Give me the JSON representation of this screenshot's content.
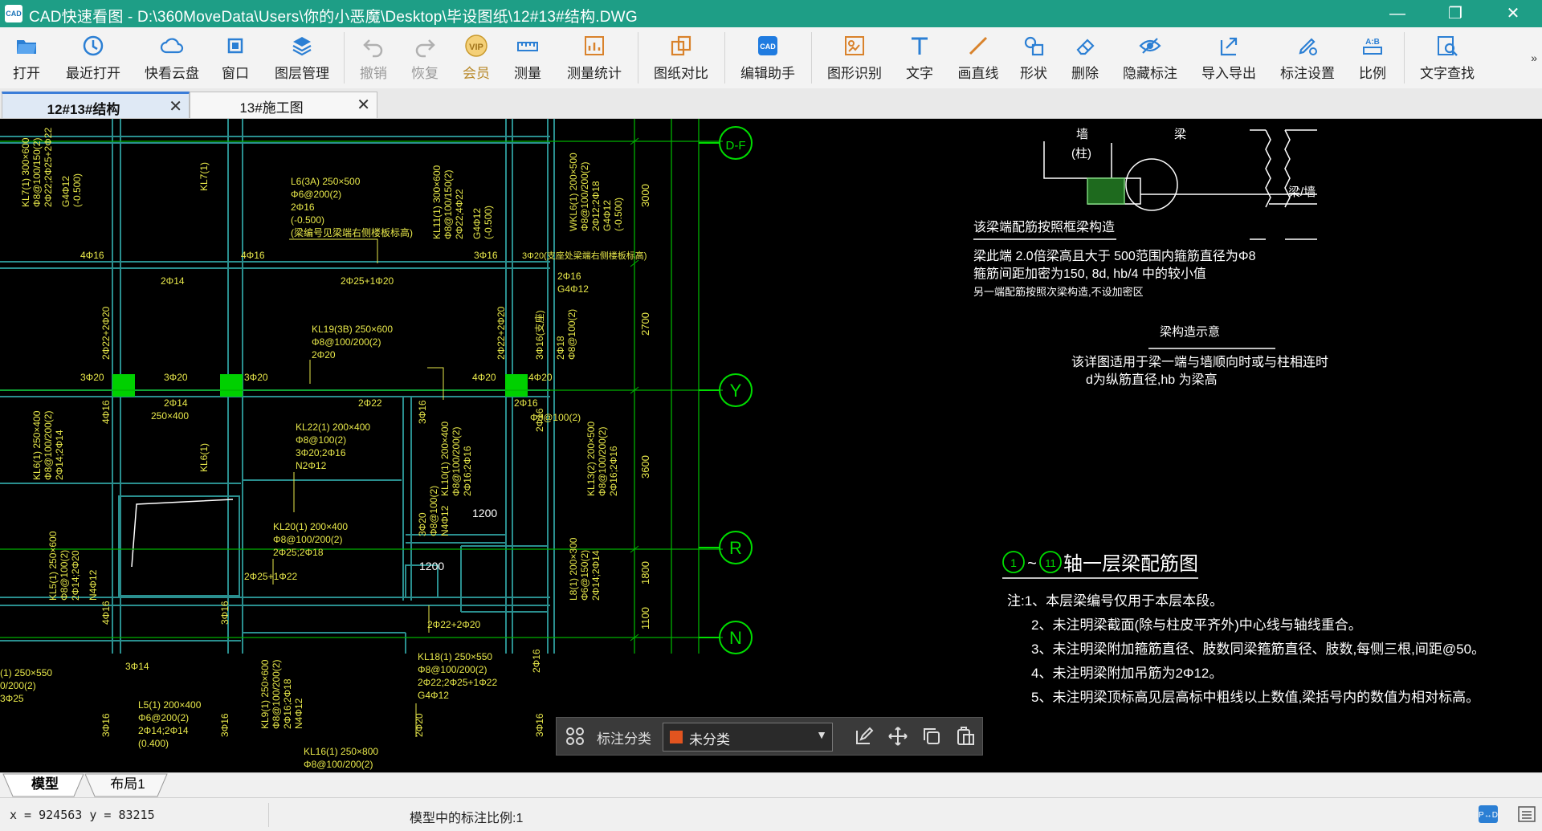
{
  "window": {
    "title": "CAD快速看图 - D:\\360MoveData\\Users\\你的小恶魔\\Desktop\\毕设图纸\\12#13#结构.DWG",
    "icon_text": "CAD",
    "controls": [
      "minimize-icon",
      "maximize-icon",
      "close-icon"
    ]
  },
  "toolbar": {
    "items": [
      {
        "label": "打开",
        "icon": "folder-open-icon"
      },
      {
        "label": "最近打开",
        "icon": "recent-icon"
      },
      {
        "label": "快看云盘",
        "icon": "cloud-icon"
      },
      {
        "label": "窗口",
        "icon": "window-icon"
      },
      {
        "label": "图层管理",
        "icon": "layers-icon"
      },
      {
        "label": "撤销",
        "icon": "undo-icon"
      },
      {
        "label": "恢复",
        "icon": "redo-icon"
      },
      {
        "label": "会员",
        "icon": "vip-icon"
      },
      {
        "label": "测量",
        "icon": "measure-icon"
      },
      {
        "label": "测量统计",
        "icon": "measure-stats-icon"
      },
      {
        "label": "图纸对比",
        "icon": "compare-icon"
      },
      {
        "label": "编辑助手",
        "icon": "edit-assistant-icon"
      },
      {
        "label": "图形识别",
        "icon": "shape-recognize-icon"
      },
      {
        "label": "文字",
        "icon": "text-icon"
      },
      {
        "label": "画直线",
        "icon": "line-icon"
      },
      {
        "label": "形状",
        "icon": "shapes-icon"
      },
      {
        "label": "删除",
        "icon": "eraser-icon"
      },
      {
        "label": "隐藏标注",
        "icon": "hide-annotation-icon"
      },
      {
        "label": "导入导出",
        "icon": "import-export-icon"
      },
      {
        "label": "标注设置",
        "icon": "annotation-settings-icon"
      },
      {
        "label": "比例",
        "icon": "scale-icon"
      },
      {
        "label": "文字查找",
        "icon": "text-search-icon"
      }
    ],
    "more": "»"
  },
  "tabs": [
    {
      "label": "12#13#结构",
      "active": true
    },
    {
      "label": "13#施工图",
      "active": false
    }
  ],
  "drawing": {
    "axes": [
      "D-F",
      "Y",
      "R",
      "N"
    ],
    "dims": [
      "3000",
      "2700",
      "3600",
      "1800",
      "1100"
    ],
    "boxes": [
      "1200",
      "1200"
    ],
    "labels_left": [
      "KL7(1) 300×600",
      "Φ8@100/150(2)",
      "2Φ22;2Φ25+2Φ22",
      "G4Φ12",
      "(-0.500)",
      "4Φ16",
      "4Φ16",
      "2Φ14",
      "KL7(1)",
      "2Φ25+1Φ20",
      "L6(3A) 250×500",
      "Φ6@200(2)",
      "2Φ16",
      "(-0.500)",
      "(梁编号见梁端右侧楼板标高)",
      "KL11(1) 300×600",
      "Φ8@100/150(2)",
      "2Φ22;4Φ22",
      "G4Φ12",
      "(-0.500)",
      "3Φ16",
      "3Φ20(支座处梁端右侧楼板标高)",
      "WKL6(1) 200×500",
      "Φ8@100/200(2)",
      "2Φ12;2Φ18",
      "G4Φ12",
      "(-0.500)",
      "2Φ16",
      "G4Φ12",
      "KL19(3B) 250×600",
      "Φ8@100/200(2)",
      "2Φ20",
      "2Φ22+2Φ20",
      "2Φ18",
      "Φ8@100(2)",
      "3Φ16(支座)",
      "2Φ22+2Φ20",
      "3Φ20",
      "3Φ20",
      "3Φ20",
      "4Φ20",
      "4Φ20",
      "2Φ14",
      "250×400",
      "2Φ22",
      "2Φ16",
      "Φ8@100(2)",
      "KL6(1) 250×400",
      "Φ8@100/200(2)",
      "2Φ14;2Φ14",
      "4Φ16",
      "KL6(1)",
      "KL22(1) 200×400",
      "Φ8@100(2)",
      "3Φ20;2Φ16",
      "N2Φ12",
      "KL10(1) 200×400",
      "Φ8@100/200(2)",
      "2Φ16;2Φ16",
      "KL13(2) 200×500",
      "Φ8@100/200(2)",
      "2Φ16;2Φ16",
      "3Φ16",
      "2Φ16",
      "3Φ20",
      "Φ8@100(2)",
      "N4Φ12",
      "KL20(1) 200×400",
      "Φ8@100/200(2)",
      "2Φ25;2Φ18",
      "2Φ25+1Φ22",
      "KL5(1) 250×600",
      "Φ8@100(2)",
      "2Φ14;2Φ20",
      "N4Φ12",
      "L8(1) 200×300",
      "Φ6@150(2)",
      "2Φ14;2Φ14",
      "2Φ22+2Φ20",
      "4Φ16",
      "3Φ16",
      "(1) 250×550",
      "0/200(2)",
      "3Φ25",
      "3Φ14",
      "KL9(1) 250×600",
      "Φ8@100/200(2)",
      "2Φ16;2Φ18",
      "N4Φ12",
      "L5(1) 200×400",
      "Φ6@200(2)",
      "2Φ14;2Φ14",
      "(0.400)",
      "KL18(1) 250×550",
      "Φ8@100/200(2)",
      "2Φ22;2Φ25+1Φ22",
      "G4Φ12",
      "2Φ16",
      "3Φ16",
      "3Φ16",
      "2Φ20",
      "3Φ16",
      "KL16(1) 250×800",
      "Φ8@100/200(2)"
    ],
    "detail": {
      "wall_label": "墙",
      "col_label": "(柱)",
      "beam_label": "梁",
      "beam_wall": "梁/墙",
      "caption": "该梁端配筋按照框梁构造",
      "line1": "梁此端 2.0倍梁高且大于 500范围内箍筋直径为Φ8",
      "line2": "箍筋间距加密为150, 8d, hb/4 中的较小值",
      "line3": "另一端配筋按照次梁构造,不设加密区",
      "title2": "梁构造示意",
      "line4": "该详图适用于梁一端与墙顺向时或与柱相连时",
      "line5": "d为纵筋直径,hb 为梁高"
    },
    "notes": {
      "circle1": "1",
      "tilde": "~",
      "circle2": "11",
      "title": "轴一层梁配筋图",
      "n1": "注:1、本层梁编号仅用于本层本段。",
      "n2": "2、未注明梁截面(除与柱皮平齐外)中心线与轴线重合。",
      "n3": "3、未注明梁附加箍筋直径、肢数同梁箍筋直径、肢数,每侧三根,间距@50。",
      "n4": "4、未注明梁附加吊筋为2Φ12。",
      "n5": "5、未注明梁顶标高见层高标中粗线以上数值,梁括号内的数值为相对标高。"
    }
  },
  "floatbar": {
    "label": "标注分类",
    "selected": "未分类",
    "swatch_color": "#e2541f",
    "icons": [
      "grid-icon",
      "edit-annotation-icon",
      "move-icon",
      "copy-icon",
      "paste-icon"
    ]
  },
  "layout_tabs": [
    "模型",
    "布局1"
  ],
  "status": {
    "coords": "x = 924563  y = 83215",
    "scale_text": "模型中的标注比例:1",
    "icons": [
      "pan-zoom-icon",
      "menu-icon"
    ]
  },
  "colors": {
    "title_bg": "#1e9e86",
    "cad_bg": "#000000",
    "beam": "#2a8f8f",
    "axis": "#00cc00",
    "text": "#e8e84a",
    "white": "#ffffff"
  }
}
